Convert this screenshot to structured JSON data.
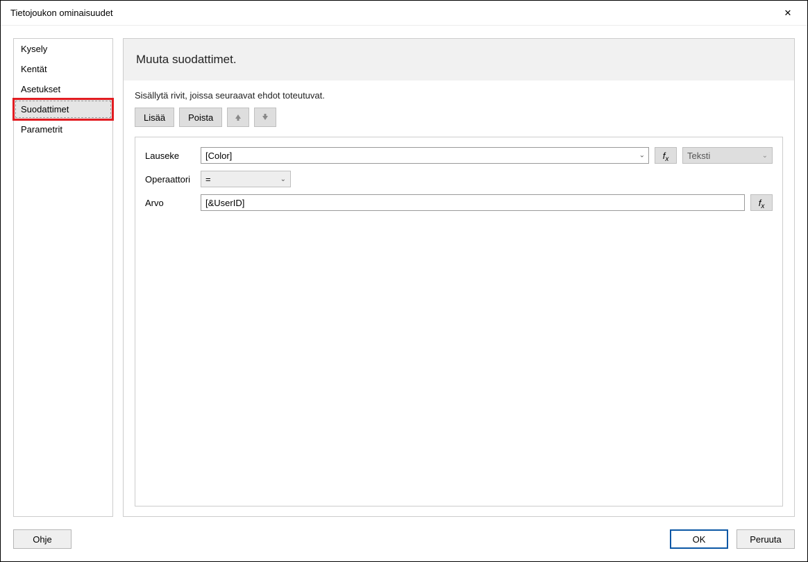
{
  "title": "Tietojoukon ominaisuudet",
  "sidebar": {
    "items": [
      {
        "label": "Kysely"
      },
      {
        "label": "Kentät"
      },
      {
        "label": "Asetukset"
      },
      {
        "label": "Suodattimet"
      },
      {
        "label": "Parametrit"
      }
    ]
  },
  "header": {
    "title": "Muuta suodattimet."
  },
  "info_text": "Sisällytä rivit, joissa seuraavat ehdot toteutuvat.",
  "toolbar": {
    "add_label": "Lisää",
    "remove_label": "Poista"
  },
  "filter": {
    "expression_label": "Lauseke",
    "expression_value": "[Color]",
    "type_label": "Teksti",
    "operator_label": "Operaattori",
    "operator_value": "=",
    "value_label": "Arvo",
    "value_value": "[&UserID]"
  },
  "buttons": {
    "help": "Ohje",
    "ok": "OK",
    "cancel": "Peruuta"
  }
}
